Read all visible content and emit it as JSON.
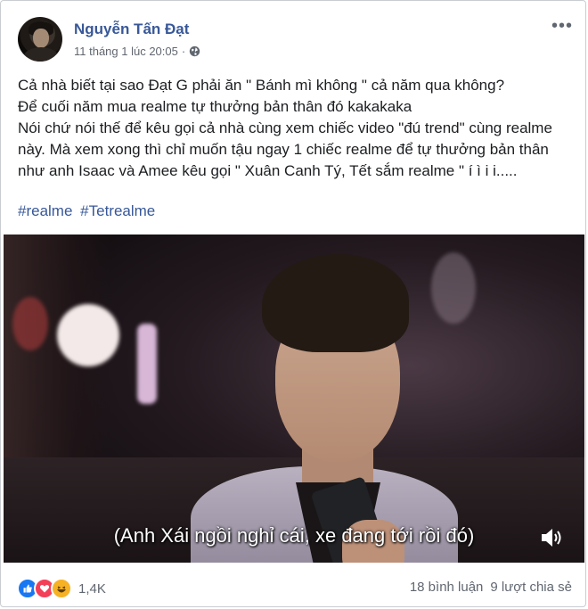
{
  "post": {
    "author": "Nguyễn Tấn Đạt",
    "timestamp": "11 tháng 1 lúc 20:05",
    "separator": "·",
    "privacy_icon": "globe-icon",
    "more_icon": "more-options-icon",
    "more_label": "•••",
    "text_lines": [
      "Cả nhà biết tại sao Đạt G phải ăn \" Bánh mì không \" cả năm qua không?",
      "Để cuối năm mua realme tự thưởng bản thân đó kakakaka",
      "Nói chứ nói thế để kêu gọi cả nhà cùng xem chiếc video \"đú trend\" cùng realme này. Mà xem xong thì chỉ muốn tậu ngay 1 chiếc realme để tự thưởng bản thân như anh Isaac và Amee kêu gọi \" Xuân Canh Tý, Tết sắm realme \" í ì i i....."
    ],
    "hashtags": [
      "#realme",
      "#Tetrealme"
    ]
  },
  "video": {
    "subtitle": "(Anh Xái ngồi nghỉ cái, xe đang tới rồi đó)",
    "volume_icon": "volume-icon"
  },
  "footer": {
    "reaction_icons": [
      "like-icon",
      "love-icon",
      "haha-icon"
    ],
    "reaction_count": "1,4K",
    "comments": "18 bình luận",
    "shares": "9 lượt chia sẻ"
  },
  "colors": {
    "link_blue": "#385898",
    "secondary_text": "#616770",
    "like": "#1877f2",
    "love": "#f33e58",
    "haha": "#f7b125"
  }
}
